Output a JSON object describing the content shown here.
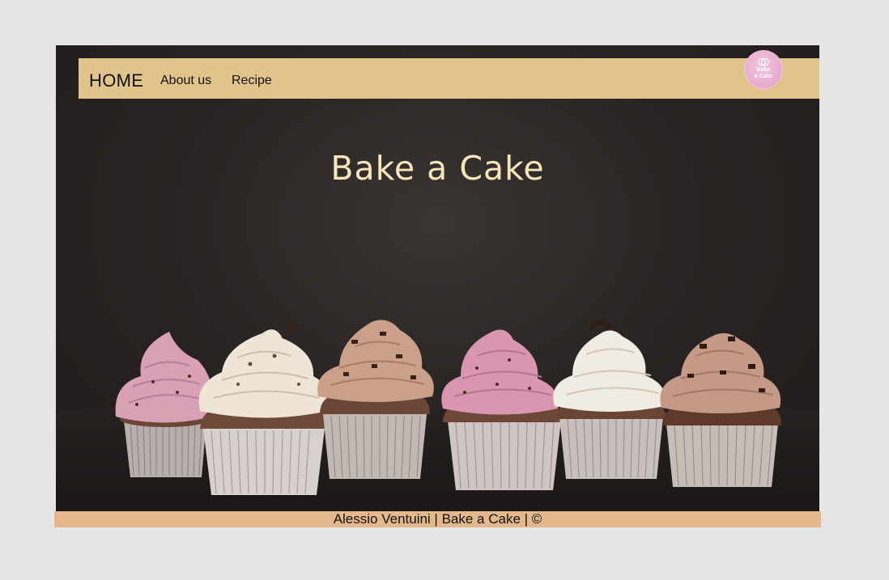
{
  "nav": {
    "home_label": "HOME",
    "about_label": "About us",
    "recipe_label": "Recipe"
  },
  "logo": {
    "text": "Bake\na Cake"
  },
  "hero": {
    "title": "Bake a Cake"
  },
  "footer": {
    "text": "Alessio Ventuini | Bake a Cake | ©"
  },
  "colors": {
    "page_background": "#e6e6e6",
    "navbar": "#e0c489",
    "footer": "#e4b88a",
    "hero_background": "#2a2524",
    "title": "#f7e6b8",
    "logo_pink": "#e7a9cc"
  },
  "cupcakes": [
    {
      "frosting": "#d9a0b6",
      "liner": "#b9afae"
    },
    {
      "frosting": "#eee5d6",
      "liner": "#d7d0cc"
    },
    {
      "frosting": "#caa08a",
      "liner": "#c2b8b4"
    },
    {
      "frosting": "#d896b1",
      "liner": "#cfc5c2"
    },
    {
      "frosting": "#f1ece3",
      "liner": "#c8c0bc"
    },
    {
      "frosting": "#c49a86",
      "liner": "#c6bdb9"
    }
  ]
}
